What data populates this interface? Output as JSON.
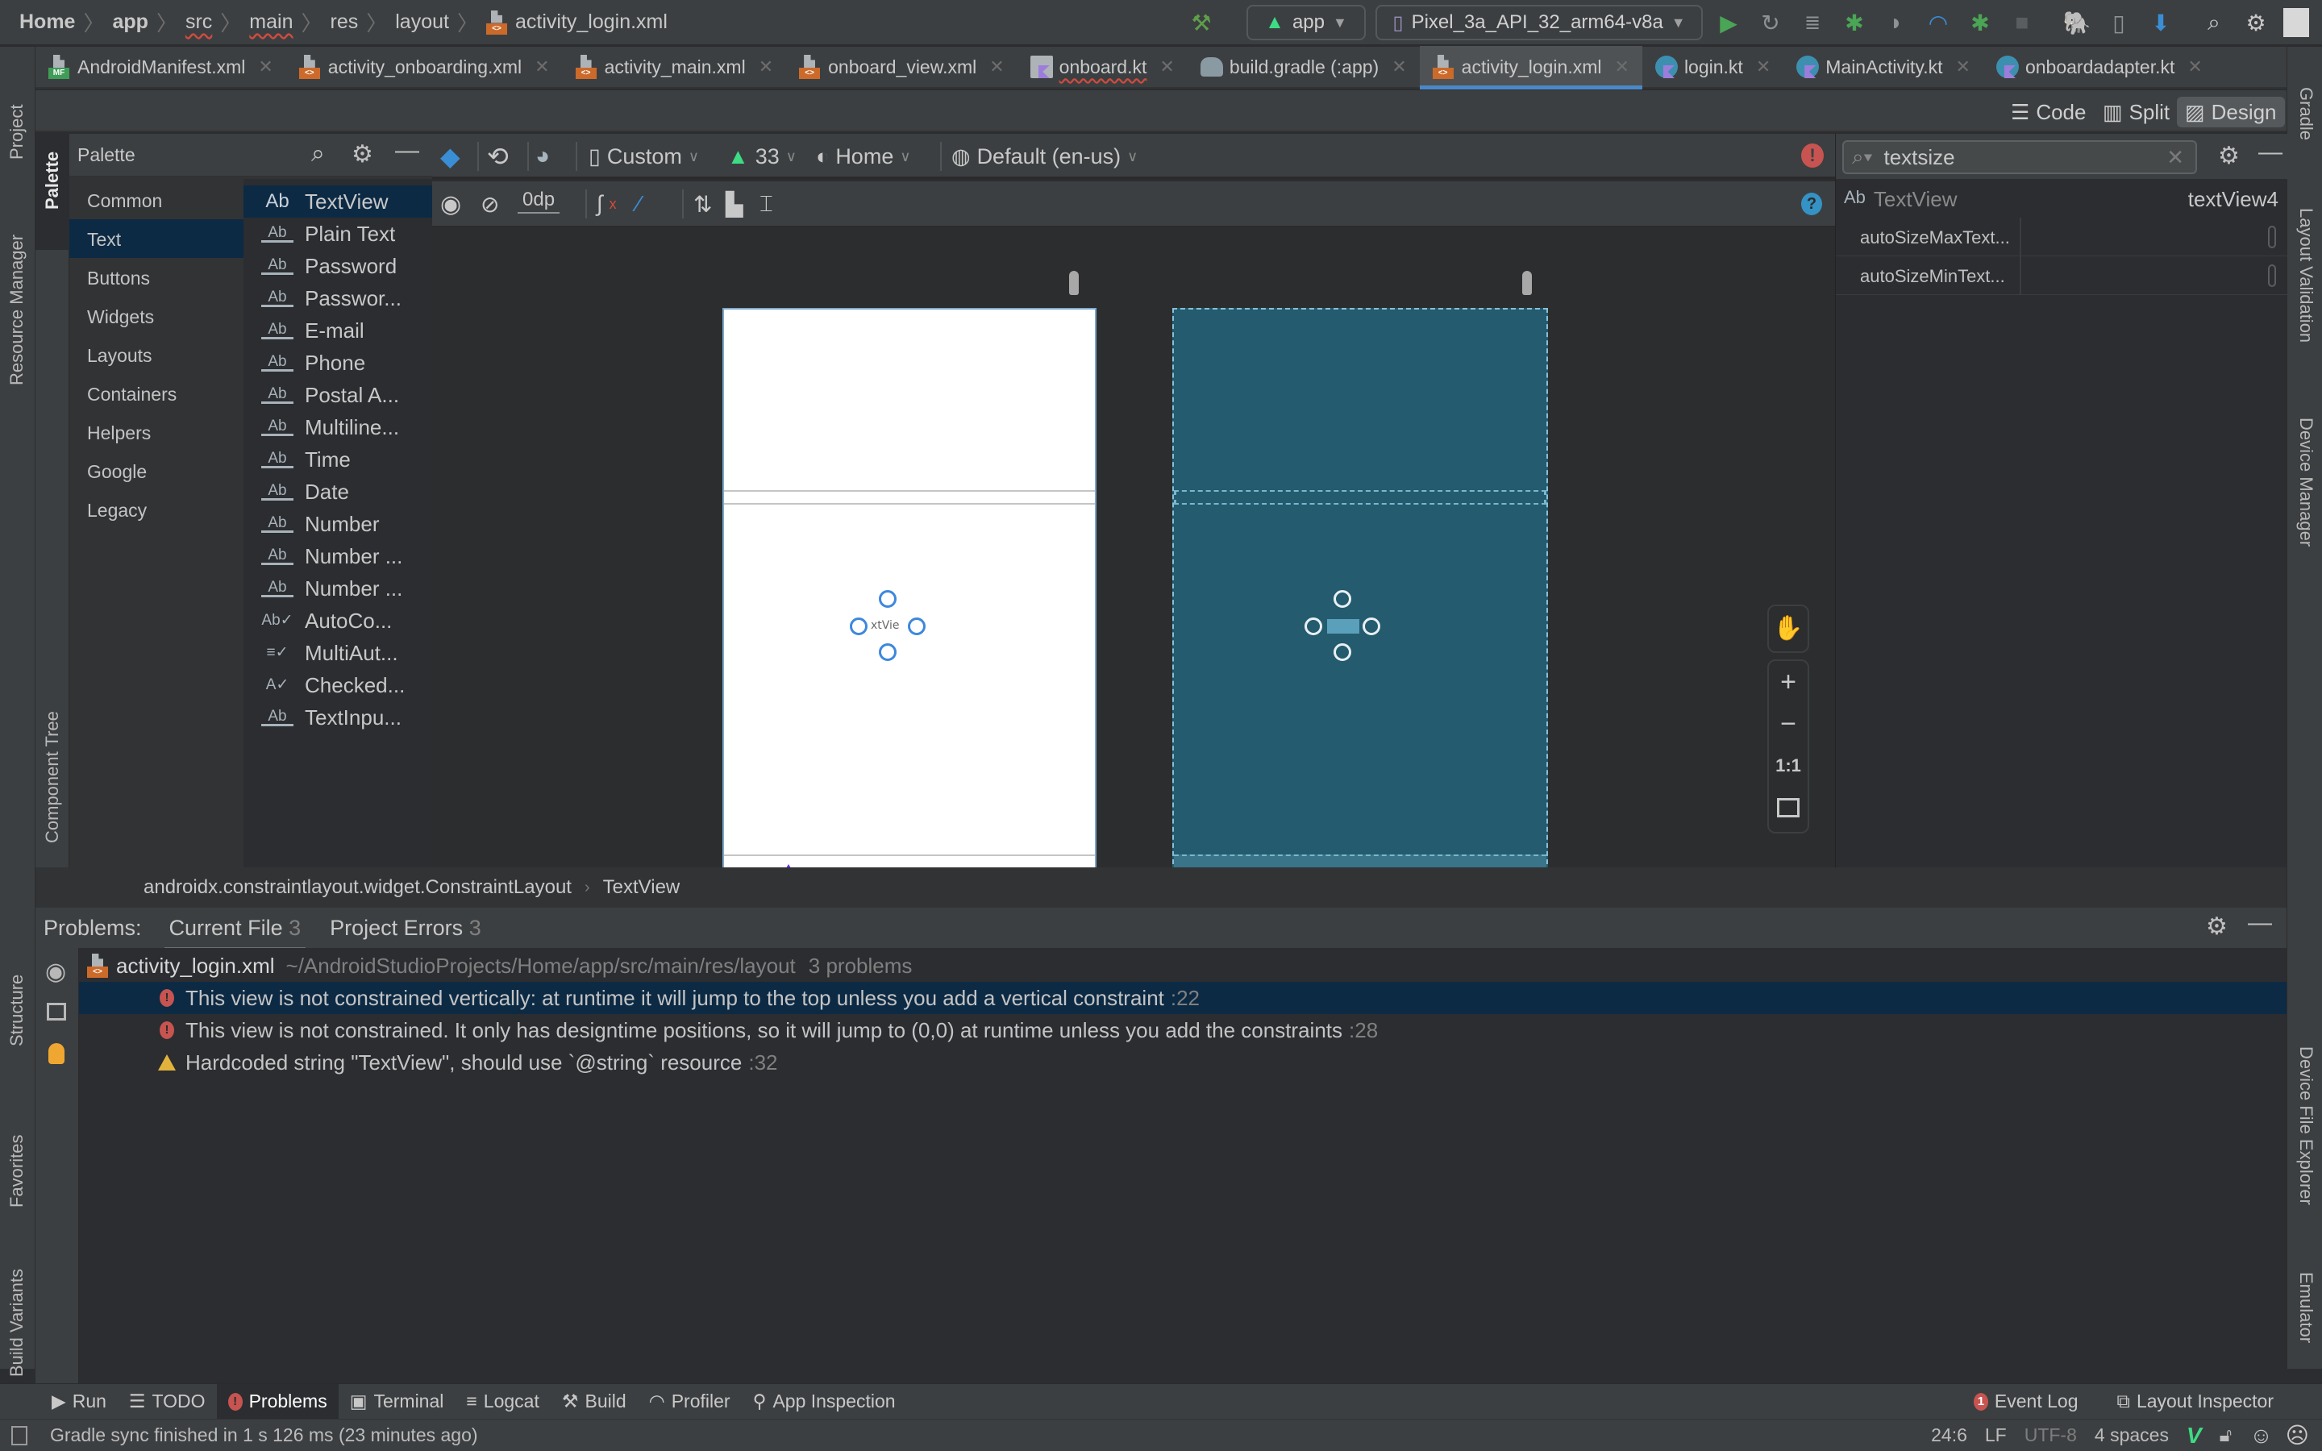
{
  "navbar": {
    "breadcrumbs": [
      "Home",
      "app",
      "src",
      "main",
      "res",
      "layout"
    ],
    "current_file": "activity_login.xml",
    "run_config": "app",
    "device": "Pixel_3a_API_32_arm64-v8a",
    "icons": [
      "hammer-icon",
      "run-icon",
      "apply-changes-icon",
      "apply-code-changes-icon",
      "debug-icon",
      "attach-debugger-icon",
      "profile-icon",
      "debug-attach-icon",
      "stop-icon",
      "gradle-sync-icon",
      "device-manager-icon",
      "sdk-manager-icon",
      "search-icon",
      "settings-icon",
      "avatar-icon"
    ]
  },
  "editor_tabs": [
    {
      "label": "AndroidManifest.xml",
      "type": "manifest",
      "active": false
    },
    {
      "label": "activity_onboarding.xml",
      "type": "xml",
      "active": false
    },
    {
      "label": "activity_main.xml",
      "type": "xml",
      "active": false
    },
    {
      "label": "onboard_view.xml",
      "type": "xml",
      "active": false
    },
    {
      "label": "onboard.kt",
      "type": "kotlin-file",
      "active": false,
      "error": true
    },
    {
      "label": "build.gradle (:app)",
      "type": "gradle",
      "active": false
    },
    {
      "label": "activity_login.xml",
      "type": "xml",
      "active": true
    },
    {
      "label": "login.kt",
      "type": "kotlin",
      "active": false
    },
    {
      "label": "MainActivity.kt",
      "type": "kotlin",
      "active": false
    },
    {
      "label": "onboardadapter.kt",
      "type": "kotlin",
      "active": false
    }
  ],
  "view_modes": {
    "code": "Code",
    "split": "Split",
    "design": "Design",
    "active": "Design"
  },
  "left_strip": {
    "project": "Project",
    "resource_manager": "Resource Manager",
    "structure": "Structure",
    "favorites": "Favorites",
    "build_variants": "Build Variants"
  },
  "right_strip": {
    "gradle": "Gradle",
    "layout_validation": "Layout Validation",
    "device_manager": "Device Manager",
    "device_file_explorer": "Device File Explorer",
    "emulator": "Emulator"
  },
  "palette": {
    "title": "Palette",
    "strip_palette": "Palette",
    "strip_component_tree": "Component Tree",
    "categories": [
      "Common",
      "Text",
      "Buttons",
      "Widgets",
      "Layouts",
      "Containers",
      "Helpers",
      "Google",
      "Legacy"
    ],
    "selected_category": "Text",
    "items": [
      {
        "label": "TextView",
        "icon": "Ab"
      },
      {
        "label": "Plain Text",
        "icon": "Ab"
      },
      {
        "label": "Password",
        "icon": "Ab"
      },
      {
        "label": "Passwor...",
        "icon": "Ab"
      },
      {
        "label": "E-mail",
        "icon": "Ab"
      },
      {
        "label": "Phone",
        "icon": "Ab"
      },
      {
        "label": "Postal A...",
        "icon": "Ab"
      },
      {
        "label": "Multiline...",
        "icon": "Ab"
      },
      {
        "label": "Time",
        "icon": "Ab"
      },
      {
        "label": "Date",
        "icon": "Ab"
      },
      {
        "label": "Number",
        "icon": "Ab"
      },
      {
        "label": "Number ...",
        "icon": "Ab"
      },
      {
        "label": "Number ...",
        "icon": "Ab"
      },
      {
        "label": "AutoCo...",
        "icon": "Ab✓"
      },
      {
        "label": "MultiAut...",
        "icon": "≡✓"
      },
      {
        "label": "Checked...",
        "icon": "A✓"
      },
      {
        "label": "TextInpu...",
        "icon": "Ab"
      }
    ],
    "selected_item": "TextView"
  },
  "design_toolbar": {
    "device": "Custom",
    "api_level": "33",
    "theme": "Home",
    "locale": "Default (en-us)",
    "default_margin": "0dp"
  },
  "canvas": {
    "design_view_bg": "#ffffff",
    "blueprint_view_bg": "#245b6e",
    "selected_widget_text": "xtVie",
    "zoom_controls": {
      "pan": "pan-icon",
      "zoom_in": "+",
      "zoom_out": "−",
      "actual_size": "1:1",
      "fit": "fit-screen-icon"
    }
  },
  "attributes": {
    "search_value": "textsize",
    "widget_type": "TextView",
    "widget_id": "textView4",
    "rows": [
      {
        "name": "autoSizeMaxText...",
        "value": ""
      },
      {
        "name": "autoSizeMinText...",
        "value": ""
      }
    ]
  },
  "component_breadcrumb": [
    "androidx.constraintlayout.widget.ConstraintLayout",
    "TextView"
  ],
  "problems": {
    "label": "Problems:",
    "tabs": [
      {
        "label": "Current File",
        "count": "3",
        "active": true
      },
      {
        "label": "Project Errors",
        "count": "3",
        "active": false
      }
    ],
    "file": {
      "name": "activity_login.xml",
      "path": "~/AndroidStudioProjects/Home/app/src/main/res/layout",
      "summary": "3 problems"
    },
    "items": [
      {
        "severity": "error",
        "message": "This view is not constrained vertically: at runtime it will jump to the top unless you add a vertical constraint",
        "line": ":22",
        "selected": true
      },
      {
        "severity": "error",
        "message": "This view is not constrained. It only has designtime positions, so it will jump to (0,0) at runtime unless you add the constraints",
        "line": ":28",
        "selected": false
      },
      {
        "severity": "warning",
        "message": "Hardcoded string \"TextView\", should use `@string` resource",
        "line": ":32",
        "selected": false
      }
    ]
  },
  "bottom_tabs": [
    {
      "label": "Run",
      "icon": "run-icon"
    },
    {
      "label": "TODO",
      "icon": "todo-icon"
    },
    {
      "label": "Problems",
      "icon": "problems-icon",
      "active": true
    },
    {
      "label": "Terminal",
      "icon": "terminal-icon"
    },
    {
      "label": "Logcat",
      "icon": "logcat-icon"
    },
    {
      "label": "Build",
      "icon": "build-icon"
    },
    {
      "label": "Profiler",
      "icon": "profiler-icon"
    },
    {
      "label": "App Inspection",
      "icon": "app-inspection-icon"
    }
  ],
  "bottom_right_tabs": [
    {
      "label": "Event Log",
      "badge": "1"
    },
    {
      "label": "Layout Inspector"
    }
  ],
  "status": {
    "message": "Gradle sync finished in 1 s 126 ms (23 minutes ago)",
    "position": "24:6",
    "line_ending": "LF",
    "encoding": "UTF-8",
    "indent": "4 spaces"
  },
  "colors": {
    "accent": "#4a88c7",
    "selection": "#0d2a44",
    "error": "#c75450",
    "warning": "#e2b33c",
    "android_green": "#3ddc84"
  }
}
